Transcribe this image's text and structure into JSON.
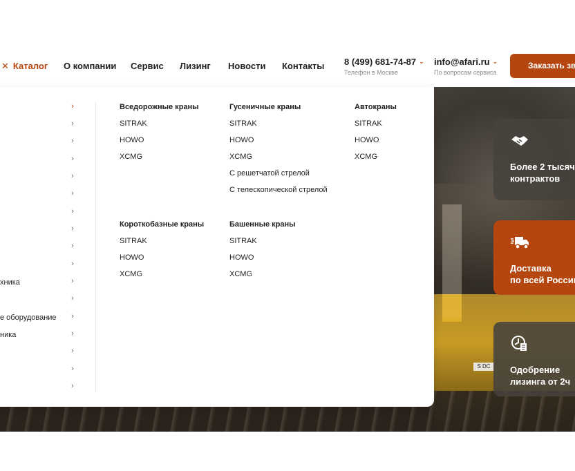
{
  "header": {
    "catalog_label": "Каталог",
    "close_glyph": "✕",
    "nav": [
      "О компании",
      "Сервис",
      "Лизинг",
      "Новости",
      "Контакты"
    ],
    "phone": "8 (499) 681-74-87",
    "phone_sub": "Телефон в Москве",
    "email": "info@afari.ru",
    "email_sub": "По вопросам сервиса",
    "cta_label": "Заказать зв"
  },
  "menu": {
    "categories": [
      {
        "label": ""
      },
      {
        "label": ""
      },
      {
        "label": ""
      },
      {
        "label": ""
      },
      {
        "label": ""
      },
      {
        "label": ""
      },
      {
        "label": ""
      },
      {
        "label": ""
      },
      {
        "label": ""
      },
      {
        "label": ""
      },
      {
        "label": "хника"
      },
      {
        "label": ""
      },
      {
        "label": "е оборудование"
      },
      {
        "label": "ника"
      },
      {
        "label": ""
      },
      {
        "label": ""
      },
      {
        "label": ""
      }
    ],
    "groups": [
      {
        "title": "Вседорожные краны",
        "items": [
          "SITRAK",
          "HOWO",
          "XCMG"
        ]
      },
      {
        "title": "Гусеничные краны",
        "items": [
          "SITRAK",
          "HOWO",
          "XCMG",
          "С решетчатой стрелой",
          "С телескопической стрелой"
        ]
      },
      {
        "title": "Автокраны",
        "items": [
          "SITRAK",
          "HOWO",
          "XCMG"
        ]
      },
      {
        "title": "Короткобазные краны",
        "items": [
          "SITRAK",
          "HOWO",
          "XCMG"
        ]
      },
      {
        "title": "Башенные краны",
        "items": [
          "SITRAK",
          "HOWO",
          "XCMG"
        ]
      }
    ]
  },
  "features": [
    {
      "icon": "handshake-icon",
      "line1": "Более 2 тысяч",
      "line2": "контрактов"
    },
    {
      "icon": "delivery-truck-icon",
      "line1": "Доставка",
      "line2": "по всей России"
    },
    {
      "icon": "clock-document-icon",
      "line1": "Одобрение",
      "line2": "лизинга от 2ч"
    }
  ],
  "hero": {
    "plate_text": "S DC"
  },
  "colors": {
    "accent": "#b5460f",
    "text": "#1f1f1f",
    "muted": "#8a8a8a"
  }
}
